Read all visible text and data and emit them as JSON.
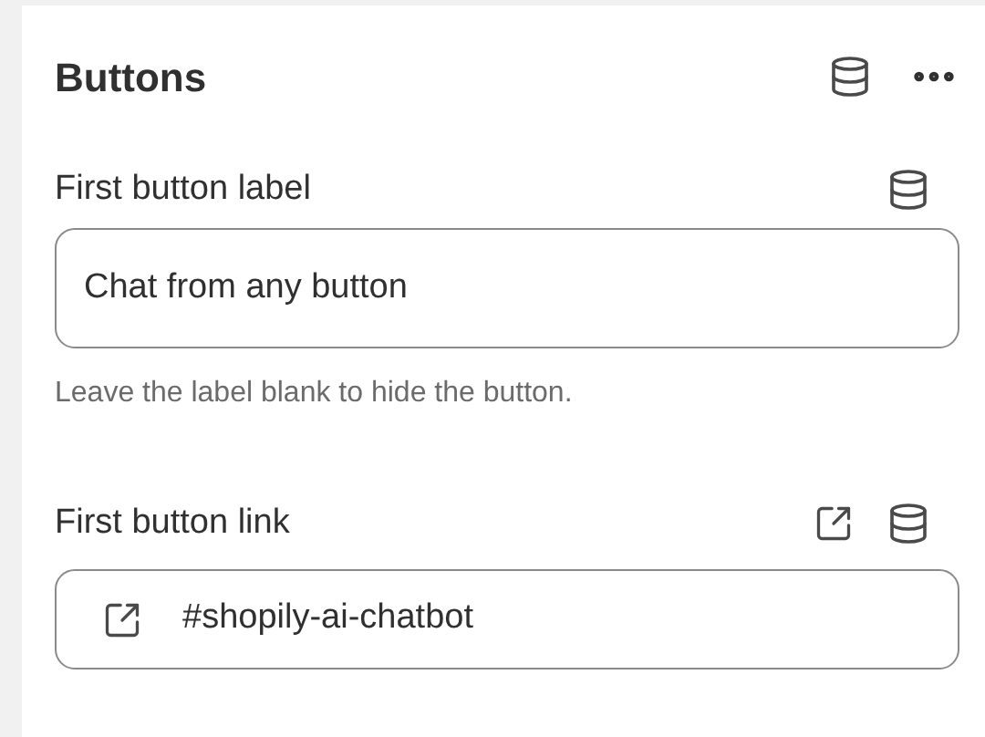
{
  "section": {
    "title": "Buttons"
  },
  "fields": [
    {
      "kind": "text",
      "label": "First button label",
      "value": "Chat from any button",
      "help": "Leave the label blank to hide the button."
    },
    {
      "kind": "link",
      "label": "First button link",
      "value": "#shopily-ai-chatbot"
    }
  ]
}
